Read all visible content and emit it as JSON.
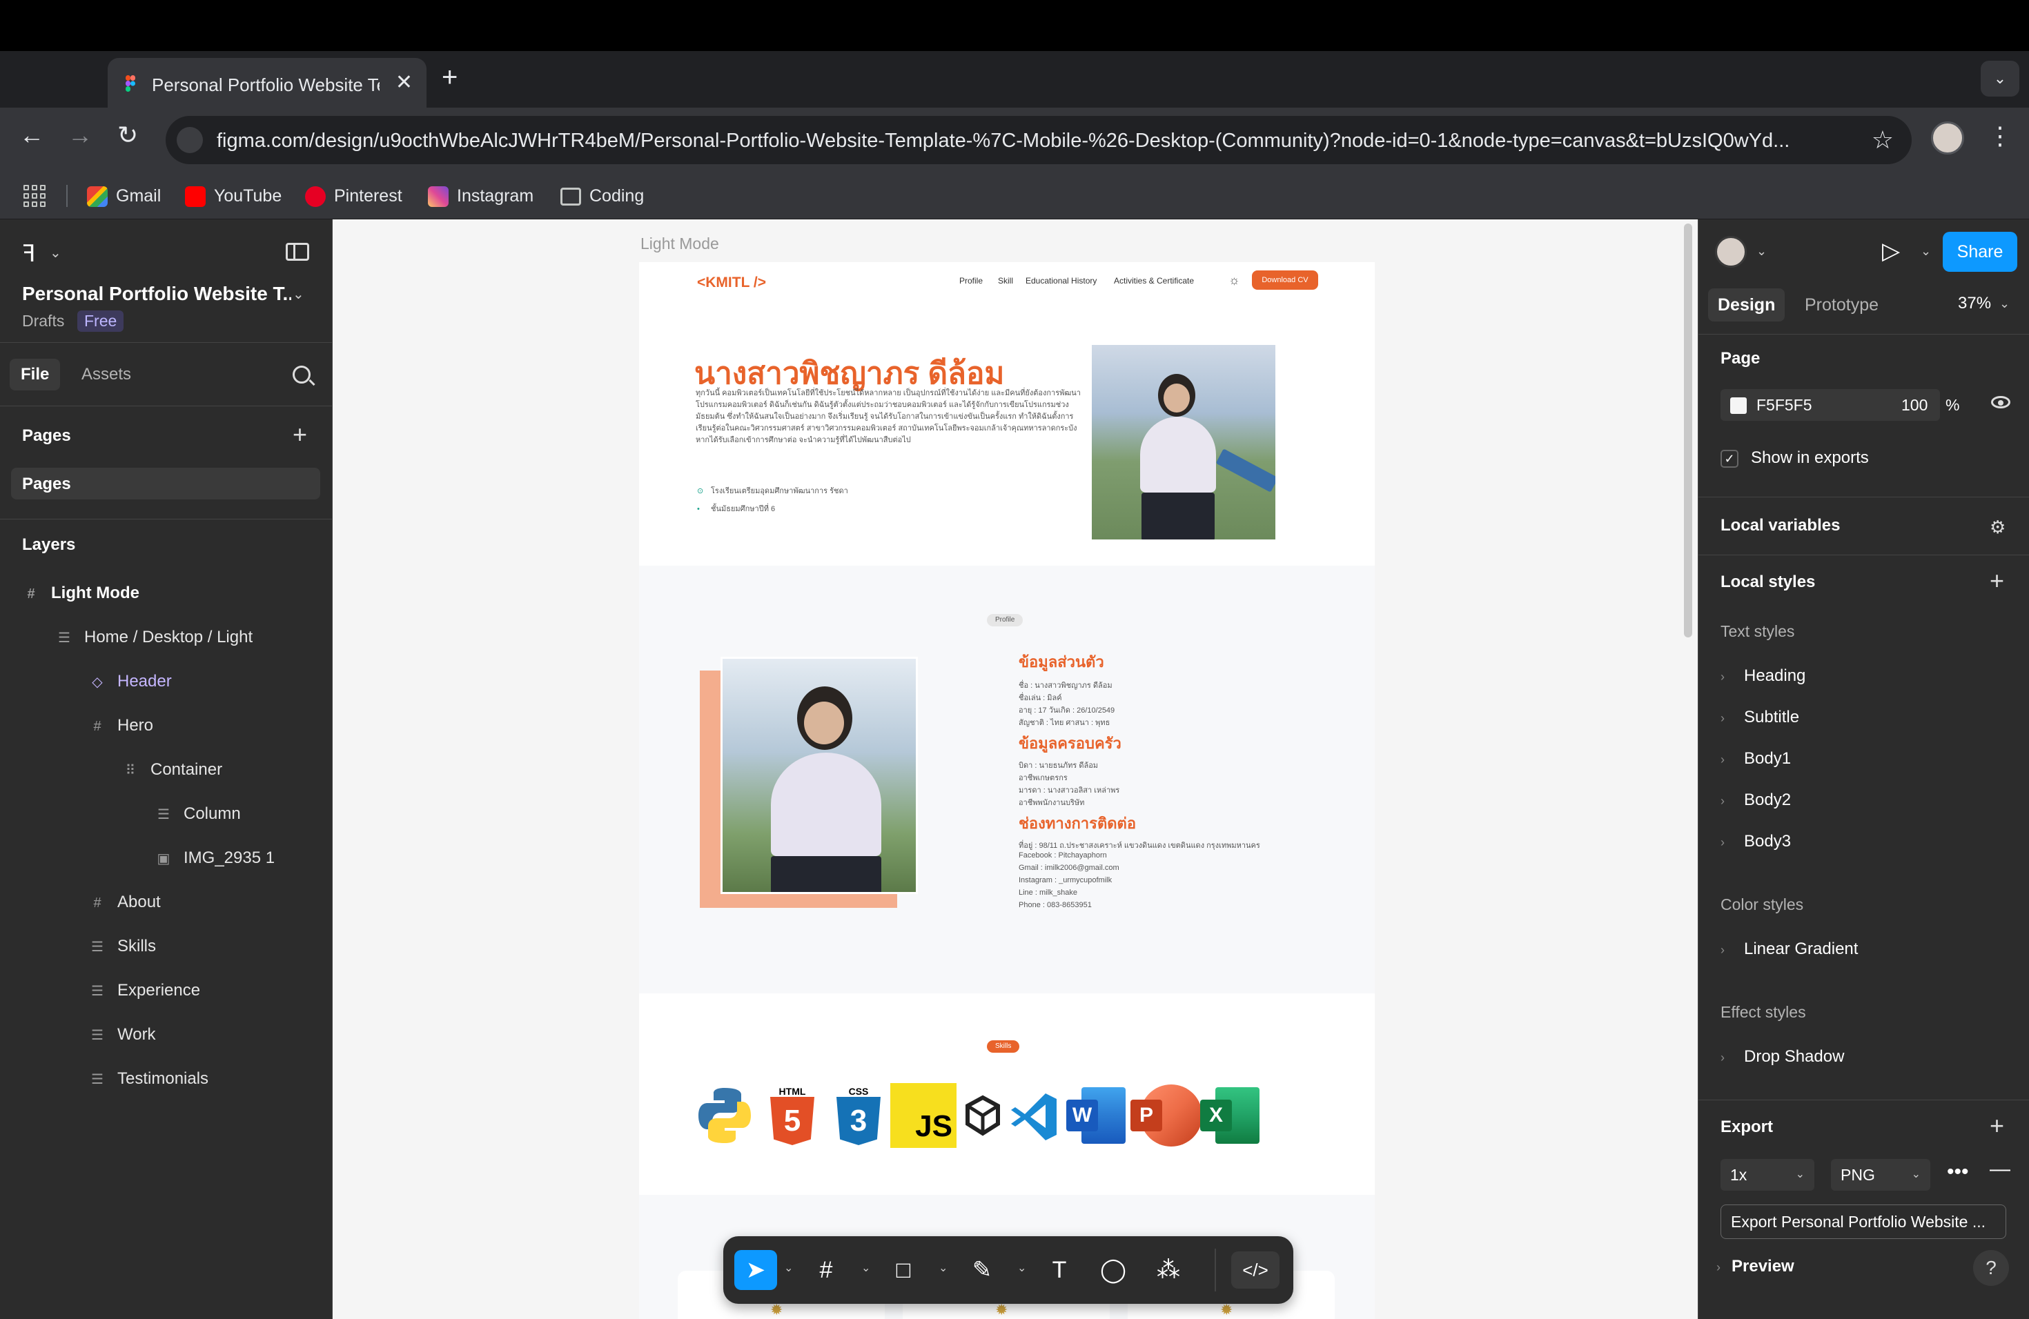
{
  "browser": {
    "tab_title": "Personal Portfolio Website Te",
    "url": "figma.com/design/u9octhWbeAlcJWHrTR4beM/Personal-Portfolio-Website-Template-%7C-Mobile-%26-Desktop-(Community)?node-id=0-1&node-type=canvas&t=bUzsIQ0wYd...",
    "bookmarks": [
      "Gmail",
      "YouTube",
      "Pinterest",
      "Instagram",
      "Coding"
    ]
  },
  "left_panel": {
    "file_name": "Personal Portfolio Website T...",
    "location": "Drafts",
    "plan_badge": "Free",
    "tabs": [
      "File",
      "Assets"
    ],
    "pages_heading": "Pages",
    "pages": [
      "Pages"
    ],
    "layers_heading": "Layers",
    "layers": [
      {
        "name": "Light Mode",
        "icon": "frame-icon"
      },
      {
        "name": "Home / Desktop / Light",
        "icon": "auto-layout-icon"
      },
      {
        "name": "Header",
        "icon": "component-icon"
      },
      {
        "name": "Hero",
        "icon": "frame-icon"
      },
      {
        "name": "Container",
        "icon": "grid-icon"
      },
      {
        "name": "Column",
        "icon": "auto-layout-icon"
      },
      {
        "name": "IMG_2935 1",
        "icon": "image-icon"
      },
      {
        "name": "About",
        "icon": "frame-icon"
      },
      {
        "name": "Skills",
        "icon": "auto-layout-icon"
      },
      {
        "name": "Experience",
        "icon": "auto-layout-icon"
      },
      {
        "name": "Work",
        "icon": "auto-layout-icon"
      },
      {
        "name": "Testimonials",
        "icon": "auto-layout-icon"
      }
    ]
  },
  "canvas": {
    "frame_label": "Light Mode",
    "site": {
      "logo": "<KMITL />",
      "nav": [
        "Profile",
        "Skill",
        "Educational History",
        "Activities & Certificate"
      ],
      "cv_button": "Download CV",
      "hero_name": "นางสาวพิชญาภร ดีล้อม",
      "hero_text": "ทุกวันนี้ คอมพิวเตอร์เป็นเทคโนโลยีที่ใช้ประโยชน์ได้หลากหลาย เป็นอุปกรณ์ที่ใช้งานได้ง่าย และมีคนที่ยังต้องการพัฒนาโปรแกรมคอมพิวเตอร์ ดิฉันก็เช่นกัน ดิฉันรู้ตัวตั้งแต่ประถมว่าชอบคอมพิวเตอร์ และได้รู้จักกับการเขียนโปรแกรมช่วงมัธยมต้น ซึ่งทำให้ฉันสนใจเป็นอย่างมาก จึงเริ่มเรียนรู้ จนได้รับโอกาสในการเข้าแข่งขันเป็นครั้งแรก ทำให้ดิฉันตั้งการเรียนรู้ต่อในคณะวิศวกรรมศาสตร์ สาขาวิศวกรรมคอมพิวเตอร์ สถาบันเทคโนโลยีพระจอมเกล้าเจ้าคุณทหารลาดกระบัง หากได้รับเลือกเข้าการศึกษาต่อ จะนำความรู้ที่ได้ไปพัฒนาสืบต่อไป",
      "hero_school": "โรงเรียนเตรียมอุดมศึกษาพัฒนาการ รัชดา",
      "hero_grade": "ชั้นมัธยมศึกษาปีที่ 6",
      "profile_pill": "Profile",
      "personal_title": "ข้อมูลส่วนตัว",
      "personal_lines": [
        "ชื่อ : นางสาวพิชญาภร ดีล้อม",
        "ชื่อเล่น : มิลค์",
        "อายุ : 17 วันเกิด : 26/10/2549",
        "สัญชาติ : ไทย   ศาสนา : พุทธ"
      ],
      "family_title": "ข้อมูลครอบครัว",
      "family_lines": [
        "บิดา : นายธนภัทร ดีล้อม",
        "อาชีพเกษตรกร",
        "มารดา : นางสาวอลิสา เหล่าพร",
        "อาชีพพนักงานบริษัท"
      ],
      "contact_title": "ช่องทางการติดต่อ",
      "contact_lines": [
        "ที่อยู่ : 98/11 ถ.ประชาสงเคราะห์ แขวงดินแดง เขตดินแดง กรุงเทพมหานคร",
        "Facebook : Pitchayaphorn",
        "Gmail : imilk2006@gmail.com",
        "Instagram : _urmycupofmilk",
        "Line : milk_shake",
        "Phone : 083-8653951"
      ],
      "skills_pill": "Skills",
      "skills": [
        "python-icon",
        "html5-icon",
        "css3-icon",
        "javascript-icon",
        "unity-icon",
        "vscode-icon",
        "word-icon",
        "powerpoint-icon",
        "excel-icon"
      ],
      "skill_texts": {
        "html": "HTML",
        "css": "CSS",
        "js": "JS",
        "word": "W",
        "ppt": "P",
        "excel": "X",
        "html_num": "5",
        "css_num": "3"
      }
    }
  },
  "right_panel": {
    "share_label": "Share",
    "tabs": [
      "Design",
      "Prototype"
    ],
    "zoom": "37%",
    "page_heading": "Page",
    "page_color": "F5F5F5",
    "page_opacity": "100",
    "percent_sign": "%",
    "show_in_exports": "Show in exports",
    "local_variables": "Local variables",
    "local_styles": "Local styles",
    "text_styles_heading": "Text styles",
    "text_styles": [
      "Heading",
      "Subtitle",
      "Body1",
      "Body2",
      "Body3"
    ],
    "color_styles_heading": "Color styles",
    "color_styles": [
      "Linear Gradient"
    ],
    "effect_styles_heading": "Effect styles",
    "effect_styles": [
      "Drop Shadow"
    ],
    "export_heading": "Export",
    "export_scale": "1x",
    "export_format": "PNG",
    "export_button": "Export Personal Portfolio Website ...",
    "preview": "Preview",
    "help": "?"
  },
  "colors": {
    "accent_orange": "#e8632b",
    "figma_blue": "#0d99ff",
    "panel_bg": "#2c2c2c",
    "canvas_bg": "#f5f5f5"
  }
}
